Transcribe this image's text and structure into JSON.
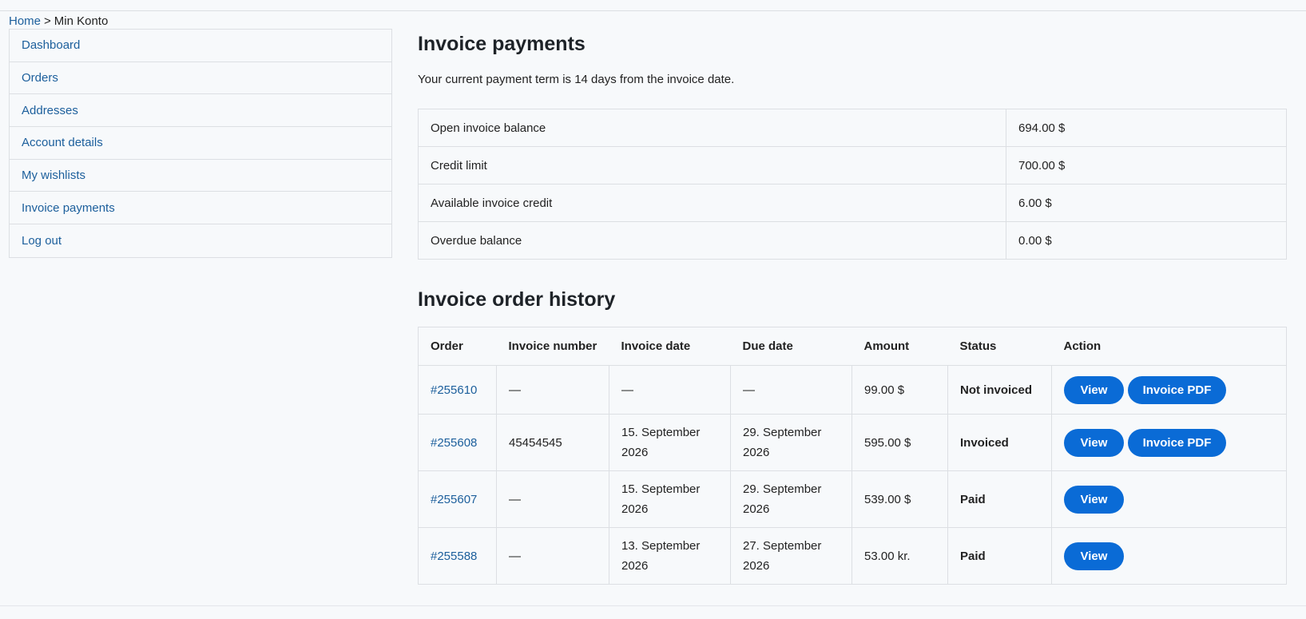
{
  "breadcrumb": {
    "home": "Home",
    "separator": ">",
    "current": "Min Konto"
  },
  "sidebar": {
    "items": [
      {
        "label": "Dashboard"
      },
      {
        "label": "Orders"
      },
      {
        "label": "Addresses"
      },
      {
        "label": "Account details"
      },
      {
        "label": "My wishlists"
      },
      {
        "label": "Invoice payments"
      },
      {
        "label": "Log out"
      }
    ]
  },
  "invoice_payments": {
    "title": "Invoice payments",
    "term_text": "Your current payment term is 14 days from the invoice date.",
    "rows": [
      {
        "label": "Open invoice balance",
        "value": "694.00 $"
      },
      {
        "label": "Credit limit",
        "value": "700.00 $"
      },
      {
        "label": "Available invoice credit",
        "value": "6.00 $"
      },
      {
        "label": "Overdue balance",
        "value": "0.00 $"
      }
    ]
  },
  "history": {
    "title": "Invoice order history",
    "columns": [
      "Order",
      "Invoice number",
      "Invoice date",
      "Due date",
      "Amount",
      "Status",
      "Action"
    ],
    "rows": [
      {
        "order": "#255610",
        "invoice_number": "—",
        "invoice_date": "—",
        "due_date": "—",
        "amount": "99.00 $",
        "status": "Not invoiced",
        "view_label": "View",
        "pdf_label": "Invoice PDF"
      },
      {
        "order": "#255608",
        "invoice_number": "45454545",
        "invoice_date": "15. September 2026",
        "due_date": "29. September 2026",
        "amount": "595.00 $",
        "status": "Invoiced",
        "view_label": "View",
        "pdf_label": "Invoice PDF"
      },
      {
        "order": "#255607",
        "invoice_number": "—",
        "invoice_date": "15. September 2026",
        "due_date": "29. September 2026",
        "amount": "539.00 $",
        "status": "Paid",
        "view_label": "View"
      },
      {
        "order": "#255588",
        "invoice_number": "—",
        "invoice_date": "13. September 2026",
        "due_date": "27. September 2026",
        "amount": "53.00 kr.",
        "status": "Paid",
        "view_label": "View"
      }
    ]
  },
  "colors": {
    "link": "#1c5f9c",
    "button": "#0a6bd6",
    "border": "#dcdfe3",
    "background": "#f7f9fb"
  }
}
